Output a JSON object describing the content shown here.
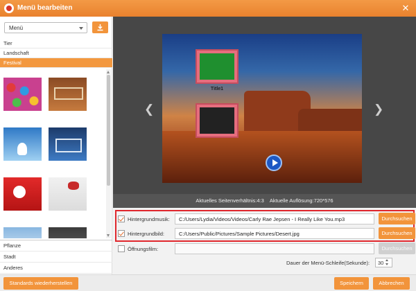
{
  "window": {
    "title": "Menü bearbeiten"
  },
  "sidebar": {
    "menu_select_value": "Menü",
    "categories_top": [
      "Tier",
      "Landschaft",
      "Festival"
    ],
    "active_category": "Festival",
    "categories_bottom": [
      "Pflanze",
      "Stadt",
      "Anderes"
    ]
  },
  "preview": {
    "frame_title": "Title1",
    "status_aspect": "Aktuelles Seitenverhältnis:4:3",
    "status_resolution": "Aktuelle Auflösung:720*576"
  },
  "settings": {
    "bg_music": {
      "checked": true,
      "label": "Hintergrundmusik:",
      "value": "C:/Users/Lydia/Videos/Videos/Carly Rae Jepsen - I Really Like You.mp3",
      "button": "Durchsuchen"
    },
    "bg_image": {
      "checked": true,
      "label": "Hintergrundbild:",
      "value": "C:/Users/Public/Pictures/Sample Pictures/Desert.jpg",
      "button": "Durchsuchen"
    },
    "opening_film": {
      "checked": false,
      "label": "Öffnungsfilm:",
      "value": "",
      "button": "Durchsuchen"
    },
    "loop_label": "Dauer der Menü-Schleife(Sekunde):",
    "loop_value": "30"
  },
  "footer": {
    "reset_label": "Standards wiederherstellen",
    "save_label": "Speichern",
    "cancel_label": "Abbrechen"
  },
  "colors": {
    "accent": "#f2943b",
    "titlebar": "#ec8632",
    "highlight": "#e0262c"
  },
  "icons": {
    "logo": "app-logo-icon",
    "close": "close-icon",
    "download": "download-icon",
    "prev": "chevron-left-icon",
    "next": "chevron-right-icon",
    "play": "play-icon"
  }
}
